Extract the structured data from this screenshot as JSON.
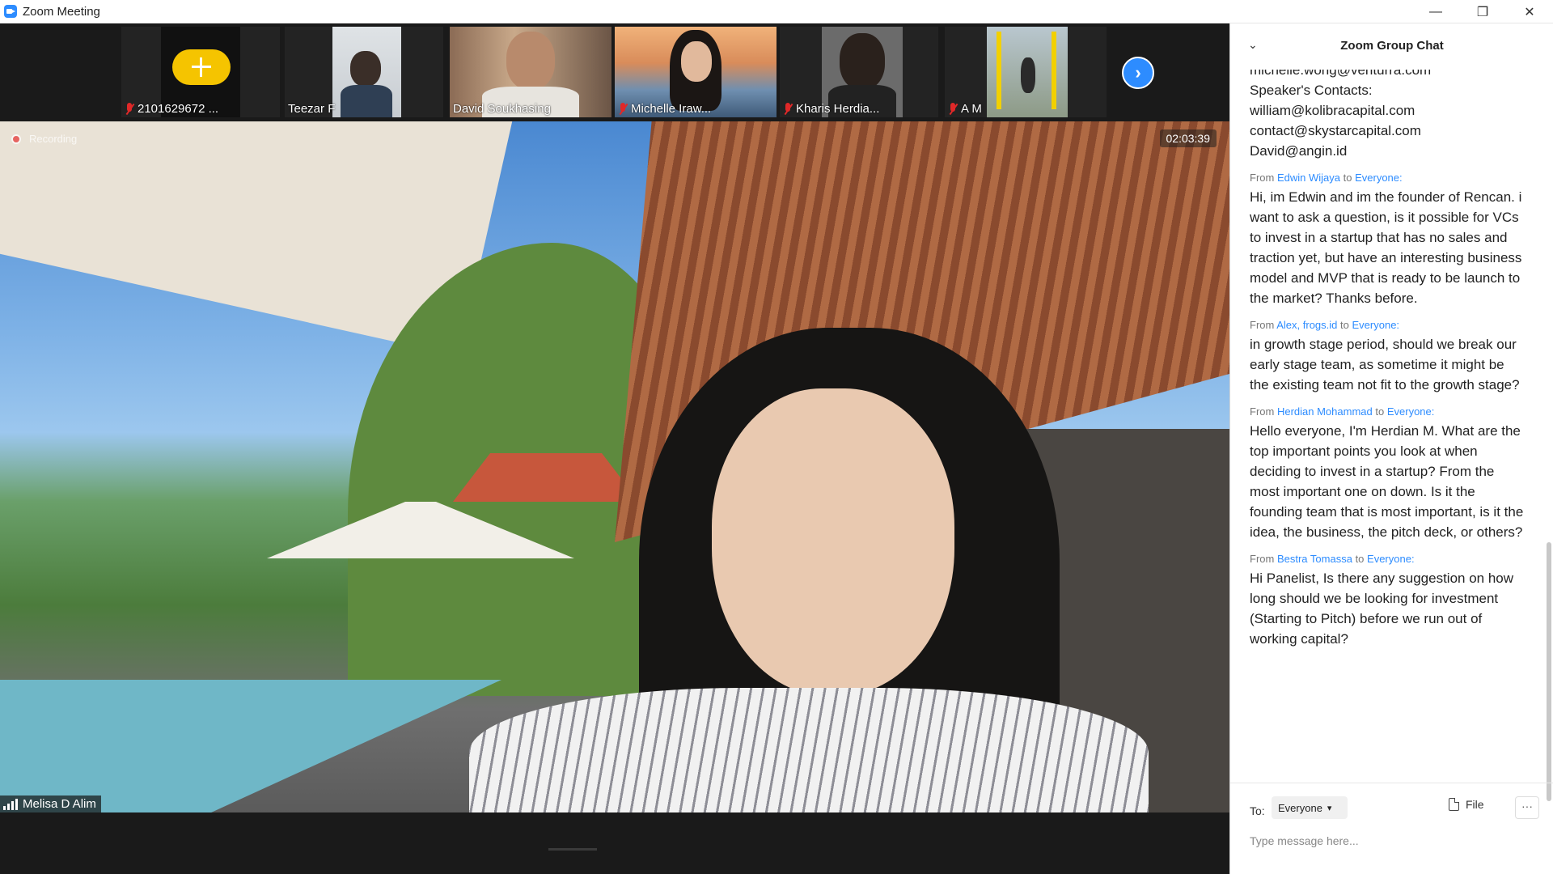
{
  "window": {
    "title": "Zoom Meeting"
  },
  "participants": [
    {
      "name": "2101629672 ...",
      "muted": true
    },
    {
      "name": "Teezar F",
      "muted": false
    },
    {
      "name": "David Soukhasing",
      "muted": false
    },
    {
      "name": "Michelle Iraw...",
      "muted": true
    },
    {
      "name": "Kharis Herdia...",
      "muted": true
    },
    {
      "name": "A M",
      "muted": true
    }
  ],
  "main_video": {
    "recording_label": "Recording",
    "timer": "02:03:39",
    "speaker_name": "Melisa D Alim"
  },
  "chat": {
    "title": "Zoom Group Chat",
    "top_lines": [
      "michelle.wong@venturra.com",
      "Speaker's Contacts:",
      "william@kolibracapital.com",
      "contact@skystarcapital.com",
      "David@angin.id"
    ],
    "messages": [
      {
        "from_label": "From",
        "from": "Edwin Wijaya",
        "to_label": "to",
        "to": "Everyone:",
        "text": "Hi, im Edwin and im the founder of Rencan. i want to ask a question, is it possible for VCs to invest in a startup that has no sales and traction yet, but have an interesting business model and MVP that is ready to be launch to the market? Thanks before."
      },
      {
        "from_label": "From",
        "from": "Alex, frogs.id",
        "to_label": "to",
        "to": "Everyone:",
        "text": "in growth stage period, should we break our early stage team, as sometime it might be the existing team not fit to the growth stage?"
      },
      {
        "from_label": "From",
        "from": "Herdian Mohammad",
        "to_label": "to",
        "to": "Everyone:",
        "text": "Hello everyone, I'm Herdian M. What are the top important points you look at when deciding to invest in a startup? From the most important one on down. Is it the founding team that is most important, is it the idea, the business, the pitch deck, or others?"
      },
      {
        "from_label": "From",
        "from": "Bestra Tomassa",
        "to_label": "to",
        "to": "Everyone:",
        "text": "Hi Panelist, Is there any suggestion on how long should we be looking for investment (Starting to Pitch) before we run out of working capital?"
      }
    ],
    "composer": {
      "to_label": "To:",
      "to_value": "Everyone",
      "file_label": "File",
      "more_label": "···",
      "placeholder": "Type message here..."
    }
  },
  "colors": {
    "accent": "#2d8cff",
    "mute_red": "#e02828"
  },
  "icons": {
    "next": "chevron-right-icon",
    "collapse": "chevron-down-icon"
  }
}
